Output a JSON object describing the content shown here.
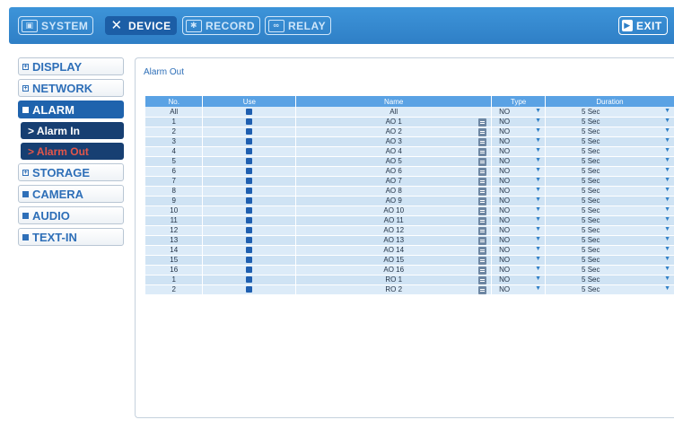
{
  "tabs": [
    {
      "label": "SYSTEM",
      "icon": "monitor-icon",
      "glyph": "▣"
    },
    {
      "label": "DEVICE",
      "icon": "tools-icon",
      "glyph": "✕"
    },
    {
      "label": "RECORD",
      "icon": "record-icon",
      "glyph": "✱"
    },
    {
      "label": "RELAY",
      "icon": "relay-icon",
      "glyph": "∞"
    }
  ],
  "exit_label": "EXIT",
  "sidebar": {
    "display": "DISPLAY",
    "network": "NETWORK",
    "alarm": "ALARM",
    "alarm_in": "> Alarm In",
    "alarm_out": "> Alarm Out",
    "storage": "STORAGE",
    "camera": "CAMERA",
    "audio": "AUDIO",
    "text_in": "TEXT-IN"
  },
  "panel_title": "Alarm Out",
  "table": {
    "headers": {
      "no": "No.",
      "use": "Use",
      "name": "Name",
      "type": "Type",
      "duration": "Duration"
    },
    "rows": [
      {
        "no": "All",
        "name": "All",
        "type": "NO",
        "duration": "5 Sec"
      },
      {
        "no": "1",
        "name": "AO 1",
        "type": "NO",
        "duration": "5 Sec"
      },
      {
        "no": "2",
        "name": "AO 2",
        "type": "NO",
        "duration": "5 Sec"
      },
      {
        "no": "3",
        "name": "AO 3",
        "type": "NO",
        "duration": "5 Sec"
      },
      {
        "no": "4",
        "name": "AO 4",
        "type": "NO",
        "duration": "5 Sec"
      },
      {
        "no": "5",
        "name": "AO 5",
        "type": "NO",
        "duration": "5 Sec"
      },
      {
        "no": "6",
        "name": "AO 6",
        "type": "NO",
        "duration": "5 Sec"
      },
      {
        "no": "7",
        "name": "AO 7",
        "type": "NO",
        "duration": "5 Sec"
      },
      {
        "no": "8",
        "name": "AO 8",
        "type": "NO",
        "duration": "5 Sec"
      },
      {
        "no": "9",
        "name": "AO 9",
        "type": "NO",
        "duration": "5 Sec"
      },
      {
        "no": "10",
        "name": "AO 10",
        "type": "NO",
        "duration": "5 Sec"
      },
      {
        "no": "11",
        "name": "AO 11",
        "type": "NO",
        "duration": "5 Sec"
      },
      {
        "no": "12",
        "name": "AO 12",
        "type": "NO",
        "duration": "5 Sec"
      },
      {
        "no": "13",
        "name": "AO 13",
        "type": "NO",
        "duration": "5 Sec"
      },
      {
        "no": "14",
        "name": "AO 14",
        "type": "NO",
        "duration": "5 Sec"
      },
      {
        "no": "15",
        "name": "AO 15",
        "type": "NO",
        "duration": "5 Sec"
      },
      {
        "no": "16",
        "name": "AO 16",
        "type": "NO",
        "duration": "5 Sec"
      },
      {
        "no": "1",
        "name": "RO 1",
        "type": "NO",
        "duration": "5 Sec"
      },
      {
        "no": "2",
        "name": "RO 2",
        "type": "NO",
        "duration": "5 Sec"
      }
    ]
  },
  "colors": {
    "topbar": "#2f7fc6",
    "active_tab": "#1c5ea6",
    "header_row": "#5aa2e4",
    "row": "#dcebf8",
    "selected_text": "#e2564a"
  }
}
